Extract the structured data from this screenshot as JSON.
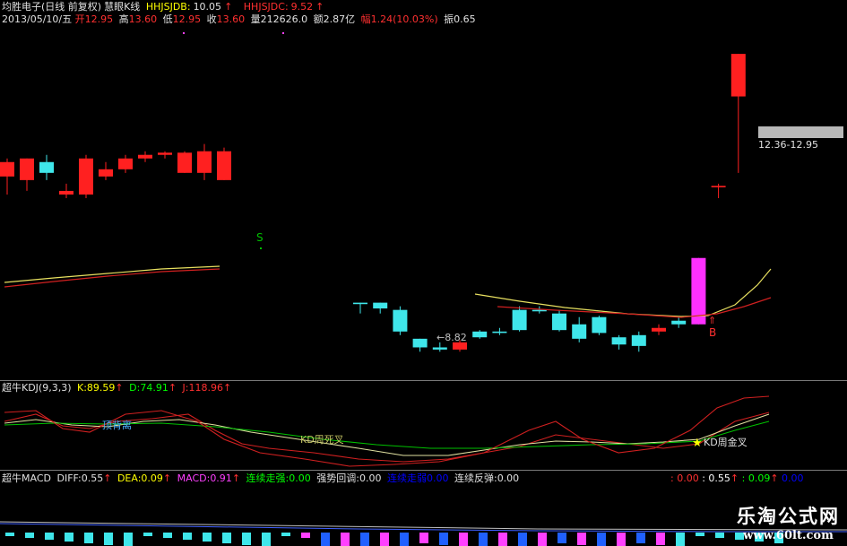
{
  "header": {
    "title": "均胜电子(日线 前复权)",
    "indicator_name": "慧眼K线",
    "hhjsjdb_label": "HHJSJDB:",
    "hhjsjdb_value": "10.05",
    "hhjsjdc_label": "HHJSJDC:",
    "hhjsjdc_value": "9.52",
    "date": "2013/05/10/五",
    "open_label": "开",
    "open_value": "12.95",
    "high_label": "高",
    "high_value": "13.60",
    "low_label": "低",
    "low_value": "12.95",
    "close_label": "收",
    "close_value": "13.60",
    "vol_label": "量",
    "vol_value": "212626.0",
    "amount_label": "额",
    "amount_value": "2.87亿",
    "change_label": "幅",
    "change_value": "1.24(10.03%)",
    "amp_label": "振",
    "amp_value": "0.65",
    "arrow": "↑"
  },
  "price_panel": {
    "price_box": "12.36-12.95",
    "low_marker": "8.82",
    "signal_sell": "S",
    "signal_buy": "B",
    "buy_arrow": "⇑"
  },
  "kdj_panel": {
    "name": "超牛KDJ(9,3,3)",
    "k_label": "K:",
    "k_value": "89.59",
    "d_label": "D:",
    "d_value": "74.91",
    "j_label": "J:",
    "j_value": "118.96",
    "annot_top": "顶背离",
    "annot_dead": "KD周死叉",
    "annot_gold": "KD周金叉"
  },
  "macd_panel": {
    "name": "超牛MACD",
    "diff_label": "DIFF:",
    "diff_value": "0.55",
    "dea_label": "DEA:",
    "dea_value": "0.09",
    "macd_label": "MACD:",
    "macd_value": "0.91",
    "strong_label": "连续走强:",
    "strong_value": "0.00",
    "pullback_label": "强势回调:",
    "pullback_value": "0.00",
    "weak_label": "连续走弱",
    "weak_value": "0.00",
    "rebound_label": "连续反弹:",
    "rebound_value": "0.00",
    "right_values": [
      ": 0.00",
      ": 0.55",
      ": 0.09",
      "0.00"
    ]
  },
  "watermark": {
    "title": "乐淘公式网",
    "url": "www.60lt.com"
  },
  "colors": {
    "up": "#ff2020",
    "down": "#3fe6ea",
    "limit_up": "#ff30ff",
    "ma_yellow": "#e8e060",
    "ma_red": "#d02020",
    "k_line": "#e0e0a0",
    "d_line": "#00c000",
    "j_line": "#d02020"
  },
  "chart_data": {
    "type": "candlestick",
    "title": "均胜电子(日线 前复权)",
    "candles": [
      {
        "o": 11.25,
        "h": 11.5,
        "l": 11.0,
        "c": 11.45,
        "up": true
      },
      {
        "o": 11.2,
        "h": 11.5,
        "l": 11.05,
        "c": 11.5,
        "up": true
      },
      {
        "o": 11.45,
        "h": 11.55,
        "l": 11.2,
        "c": 11.3,
        "up": false
      },
      {
        "o": 11.0,
        "h": 11.15,
        "l": 10.95,
        "c": 11.05,
        "up": true
      },
      {
        "o": 11.0,
        "h": 11.55,
        "l": 10.95,
        "c": 11.5,
        "up": true
      },
      {
        "o": 11.25,
        "h": 11.45,
        "l": 11.2,
        "c": 11.35,
        "up": true
      },
      {
        "o": 11.35,
        "h": 11.55,
        "l": 11.3,
        "c": 11.5,
        "up": true
      },
      {
        "o": 11.5,
        "h": 11.6,
        "l": 11.45,
        "c": 11.55,
        "up": true
      },
      {
        "o": 11.55,
        "h": 11.6,
        "l": 11.5,
        "c": 11.58,
        "up": true
      },
      {
        "o": 11.3,
        "h": 11.6,
        "l": 11.3,
        "c": 11.58,
        "up": true
      },
      {
        "o": 11.3,
        "h": 11.7,
        "l": 11.2,
        "c": 11.6,
        "up": true
      },
      {
        "o": 11.2,
        "h": 11.65,
        "l": 11.2,
        "c": 11.6,
        "up": true
      },
      {
        "o": 9.5,
        "h": 9.5,
        "l": 9.35,
        "c": 9.48,
        "up": false
      },
      {
        "o": 9.5,
        "h": 9.5,
        "l": 9.35,
        "c": 9.42,
        "up": false
      },
      {
        "o": 9.4,
        "h": 9.45,
        "l": 9.05,
        "c": 9.1,
        "up": false
      },
      {
        "o": 9.0,
        "h": 9.0,
        "l": 8.82,
        "c": 8.88,
        "up": false
      },
      {
        "o": 8.88,
        "h": 8.95,
        "l": 8.82,
        "c": 8.85,
        "up": false
      },
      {
        "o": 8.85,
        "h": 8.98,
        "l": 8.82,
        "c": 8.95,
        "up": true
      },
      {
        "o": 9.1,
        "h": 9.12,
        "l": 9.0,
        "c": 9.02,
        "up": false
      },
      {
        "o": 9.1,
        "h": 9.15,
        "l": 9.05,
        "c": 9.08,
        "up": false
      },
      {
        "o": 9.4,
        "h": 9.45,
        "l": 9.1,
        "c": 9.12,
        "up": false
      },
      {
        "o": 9.4,
        "h": 9.45,
        "l": 9.35,
        "c": 9.38,
        "up": false
      },
      {
        "o": 9.35,
        "h": 9.4,
        "l": 9.1,
        "c": 9.12,
        "up": false
      },
      {
        "o": 9.2,
        "h": 9.3,
        "l": 8.95,
        "c": 9.0,
        "up": false
      },
      {
        "o": 9.3,
        "h": 9.32,
        "l": 9.05,
        "c": 9.08,
        "up": false
      },
      {
        "o": 9.02,
        "h": 9.05,
        "l": 8.85,
        "c": 8.92,
        "up": false
      },
      {
        "o": 9.05,
        "h": 9.1,
        "l": 8.82,
        "c": 8.9,
        "up": false
      },
      {
        "o": 9.15,
        "h": 9.2,
        "l": 9.05,
        "c": 9.1,
        "up": true
      },
      {
        "o": 9.25,
        "h": 9.3,
        "l": 9.15,
        "c": 9.2,
        "up": false
      },
      {
        "o": 9.2,
        "h": 10.12,
        "l": 9.2,
        "c": 10.12,
        "up": true,
        "limit": true
      },
      {
        "o": 11.1,
        "h": 11.15,
        "l": 10.95,
        "c": 11.12,
        "up": true
      },
      {
        "o": 12.36,
        "h": 12.95,
        "l": 11.3,
        "c": 12.95,
        "up": true
      }
    ],
    "ylim": [
      8.6,
      13.2
    ]
  }
}
